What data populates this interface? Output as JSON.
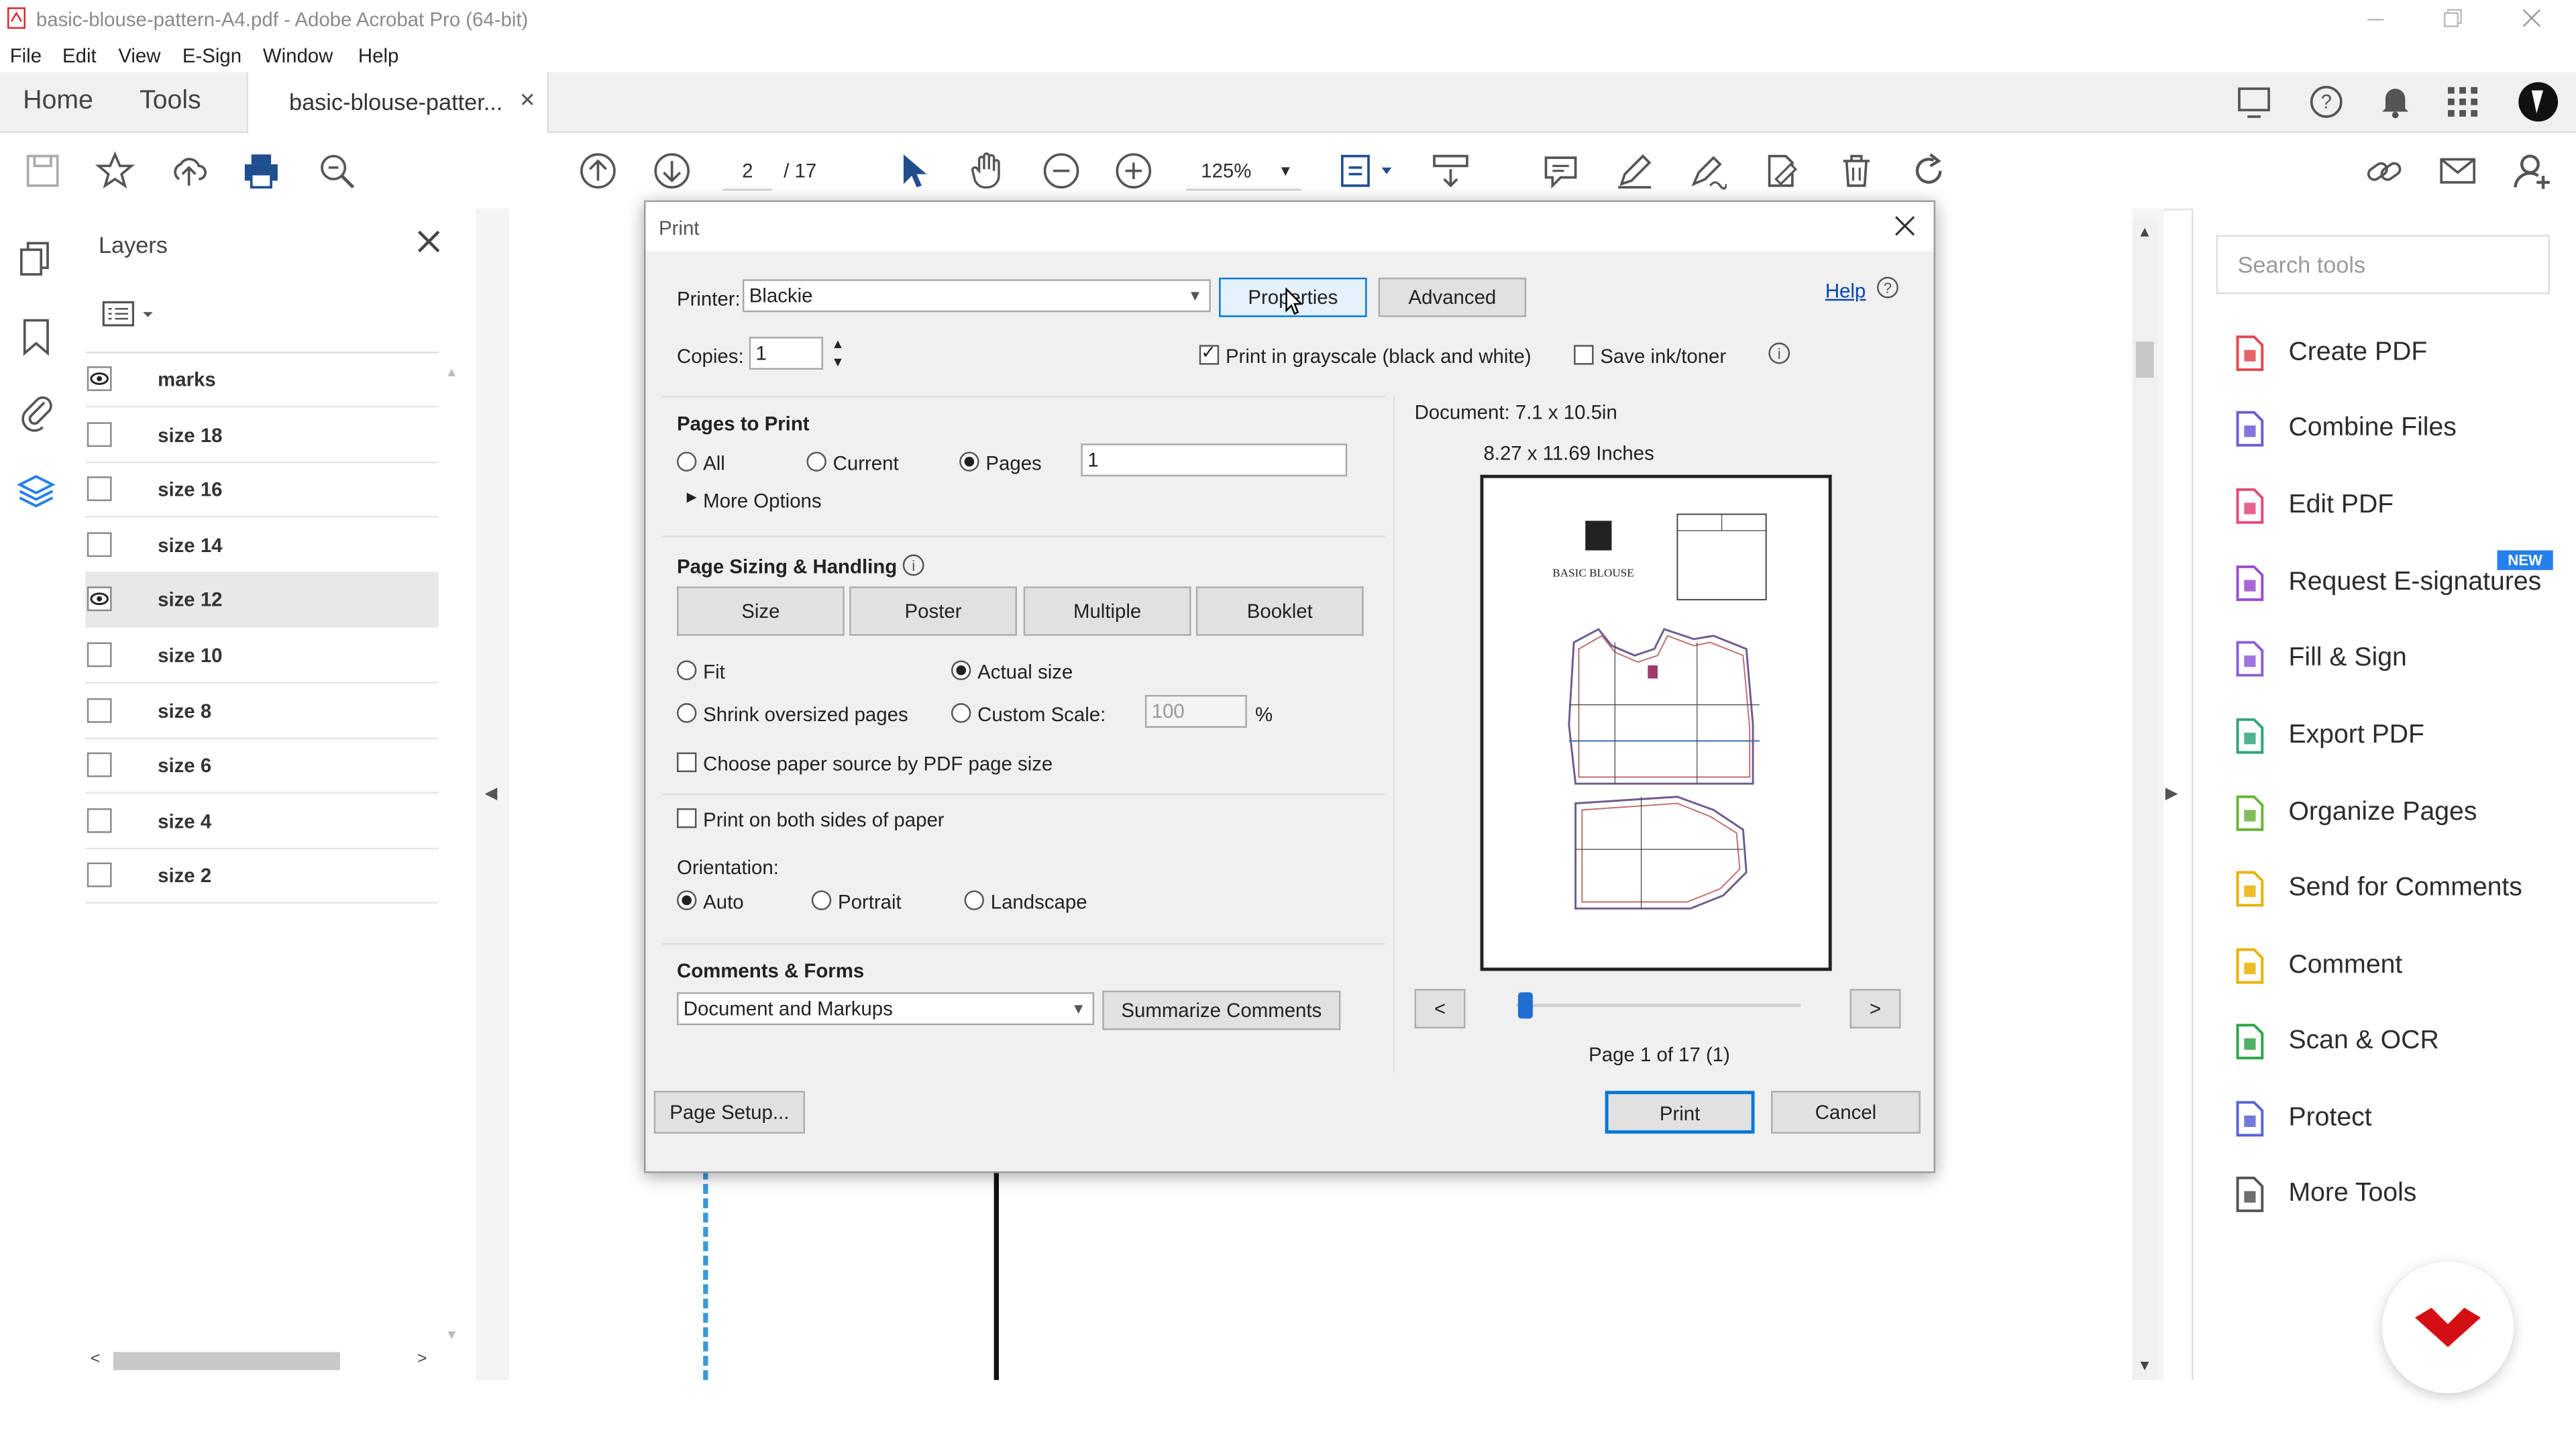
{
  "window": {
    "title": "basic-blouse-pattern-A4.pdf - Adobe Acrobat Pro (64-bit)"
  },
  "menu": [
    "File",
    "Edit",
    "View",
    "E-Sign",
    "Window",
    "Help"
  ],
  "tabs": {
    "home": "Home",
    "tools": "Tools",
    "document": "basic-blouse-patter..."
  },
  "toolbar": {
    "page_current": "2",
    "page_total": "/ 17",
    "zoom": "125%"
  },
  "layers_panel": {
    "title": "Layers",
    "items": [
      {
        "label": "marks",
        "visible": true
      },
      {
        "label": "size 18",
        "visible": false
      },
      {
        "label": "size 16",
        "visible": false
      },
      {
        "label": "size 14",
        "visible": false
      },
      {
        "label": "size 12",
        "visible": true
      },
      {
        "label": "size 10",
        "visible": false
      },
      {
        "label": "size 8",
        "visible": false
      },
      {
        "label": "size 6",
        "visible": false
      },
      {
        "label": "size 4",
        "visible": false
      },
      {
        "label": "size 2",
        "visible": false
      }
    ]
  },
  "tools_panel": {
    "search_placeholder": "Search tools",
    "new_badge": "NEW",
    "items": [
      {
        "label": "Create PDF",
        "icon": "create-pdf-icon",
        "color": "#e34850"
      },
      {
        "label": "Combine Files",
        "icon": "combine-files-icon",
        "color": "#6e5cd6"
      },
      {
        "label": "Edit PDF",
        "icon": "edit-pdf-icon",
        "color": "#e34879"
      },
      {
        "label": "Request E-signatures",
        "icon": "request-esign-icon",
        "color": "#9a4ccf"
      },
      {
        "label": "Fill & Sign",
        "icon": "fill-sign-icon",
        "color": "#8b5fd6"
      },
      {
        "label": "Export PDF",
        "icon": "export-pdf-icon",
        "color": "#2fa47a"
      },
      {
        "label": "Organize Pages",
        "icon": "organize-pages-icon",
        "color": "#6bb33a"
      },
      {
        "label": "Send for Comments",
        "icon": "send-comments-icon",
        "color": "#e8b100"
      },
      {
        "label": "Comment",
        "icon": "comment-icon",
        "color": "#e8b100"
      },
      {
        "label": "Scan & OCR",
        "icon": "scan-ocr-icon",
        "color": "#2fa447"
      },
      {
        "label": "Protect",
        "icon": "protect-icon",
        "color": "#5a63d6"
      },
      {
        "label": "More Tools",
        "icon": "more-tools-icon",
        "color": "#555555"
      }
    ]
  },
  "print_dialog": {
    "title": "Print",
    "printer_label": "Printer:",
    "printer_value": "Blackie",
    "properties_btn": "Properties",
    "advanced_btn": "Advanced",
    "help_link": "Help",
    "copies_label": "Copies:",
    "copies_value": "1",
    "grayscale_label": "Print in grayscale (black and white)",
    "grayscale_checked": true,
    "save_ink_label": "Save ink/toner",
    "pages_to_print": {
      "heading": "Pages to Print",
      "all": "All",
      "current": "Current",
      "pages": "Pages",
      "pages_value": "1",
      "more_options": "More Options"
    },
    "sizing": {
      "heading": "Page Sizing & Handling",
      "tabs": [
        "Size",
        "Poster",
        "Multiple",
        "Booklet"
      ],
      "fit": "Fit",
      "actual_size": "Actual size",
      "shrink": "Shrink oversized pages",
      "custom_scale": "Custom Scale:",
      "scale_value": "100",
      "percent": "%",
      "paper_source": "Choose paper source by PDF page size",
      "both_sides": "Print on both sides of paper",
      "orientation_label": "Orientation:",
      "auto": "Auto",
      "portrait": "Portrait",
      "landscape": "Landscape"
    },
    "comments": {
      "heading": "Comments & Forms",
      "value": "Document and Markups",
      "summarize_btn": "Summarize Comments"
    },
    "preview": {
      "document_size": "Document: 7.1 x 10.5in",
      "paper_size": "8.27 x 11.69 Inches",
      "pattern_title": "BASIC BLOUSE",
      "page_info": "Page 1 of 17 (1)",
      "prev": "<",
      "next": ">",
      "slider_position": 0
    },
    "page_setup_btn": "Page Setup...",
    "print_btn": "Print",
    "cancel_btn": "Cancel"
  }
}
